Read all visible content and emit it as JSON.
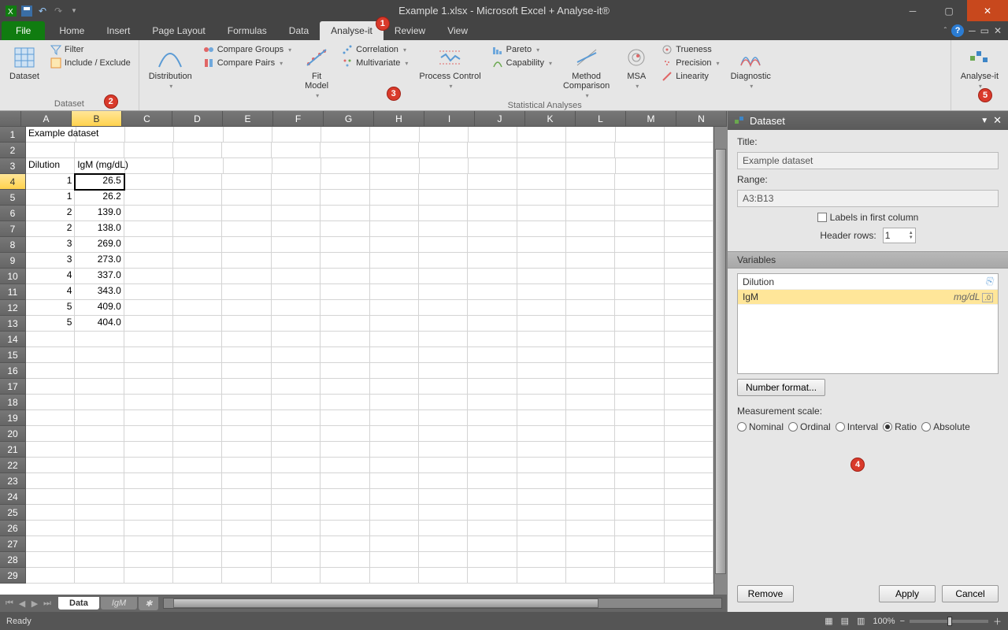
{
  "title_bar": {
    "title": "Example 1.xlsx - Microsoft Excel + Analyse-it®"
  },
  "tabs": {
    "file": "File",
    "items": [
      "Home",
      "Insert",
      "Page Layout",
      "Formulas",
      "Data",
      "Analyse-it",
      "Review",
      "View"
    ],
    "active_index": 5
  },
  "ribbon": {
    "dataset_group": {
      "label": "Dataset",
      "dataset_btn": "Dataset",
      "filter": "Filter",
      "include_exclude": "Include / Exclude"
    },
    "stat_group": {
      "label": "Statistical Analyses",
      "distribution": "Distribution",
      "compare_groups": "Compare Groups",
      "compare_pairs": "Compare Pairs",
      "fit_model": "Fit\nModel",
      "correlation": "Correlation",
      "multivariate": "Multivariate",
      "process_control": "Process Control",
      "pareto": "Pareto",
      "capability": "Capability",
      "method_comparison": "Method\nComparison",
      "msa": "MSA",
      "trueness": "Trueness",
      "precision": "Precision",
      "linearity": "Linearity",
      "diagnostic": "Diagnostic"
    },
    "analyseit_group": {
      "analyseit": "Analyse-it"
    }
  },
  "badges": {
    "b1": "1",
    "b2": "2",
    "b3": "3",
    "b4": "4",
    "b5": "5"
  },
  "columns": [
    "A",
    "B",
    "C",
    "D",
    "E",
    "F",
    "G",
    "H",
    "I",
    "J",
    "K",
    "L",
    "M",
    "N"
  ],
  "selected_col_index": 1,
  "selected_row_index": 3,
  "sheet": {
    "title_cell": "Example dataset",
    "headers": [
      "Dilution",
      "IgM (mg/dL)"
    ],
    "rows": [
      {
        "r": 4,
        "a": "1",
        "b": "26.5"
      },
      {
        "r": 5,
        "a": "1",
        "b": "26.2"
      },
      {
        "r": 6,
        "a": "2",
        "b": "139.0"
      },
      {
        "r": 7,
        "a": "2",
        "b": "138.0"
      },
      {
        "r": 8,
        "a": "3",
        "b": "269.0"
      },
      {
        "r": 9,
        "a": "3",
        "b": "273.0"
      },
      {
        "r": 10,
        "a": "4",
        "b": "337.0"
      },
      {
        "r": 11,
        "a": "4",
        "b": "343.0"
      },
      {
        "r": 12,
        "a": "5",
        "b": "409.0"
      },
      {
        "r": 13,
        "a": "5",
        "b": "404.0"
      }
    ]
  },
  "sheet_tabs": {
    "active": "Data",
    "other": "IgM"
  },
  "task_pane": {
    "header": "Dataset",
    "title_label": "Title:",
    "title_value": "Example dataset",
    "range_label": "Range:",
    "range_value": "A3:B13",
    "labels_first_col": "Labels in first column",
    "header_rows_label": "Header rows:",
    "header_rows_value": "1",
    "variables_label": "Variables",
    "vars": [
      {
        "name": "Dilution",
        "unit": ""
      },
      {
        "name": "IgM",
        "unit": "mg/dL"
      }
    ],
    "selected_var_index": 1,
    "number_format": "Number format...",
    "scale_label": "Measurement scale:",
    "scales": [
      "Nominal",
      "Ordinal",
      "Interval",
      "Ratio",
      "Absolute"
    ],
    "scale_selected_index": 3,
    "remove": "Remove",
    "apply": "Apply",
    "cancel": "Cancel"
  },
  "status": {
    "ready": "Ready",
    "zoom": "100%"
  }
}
